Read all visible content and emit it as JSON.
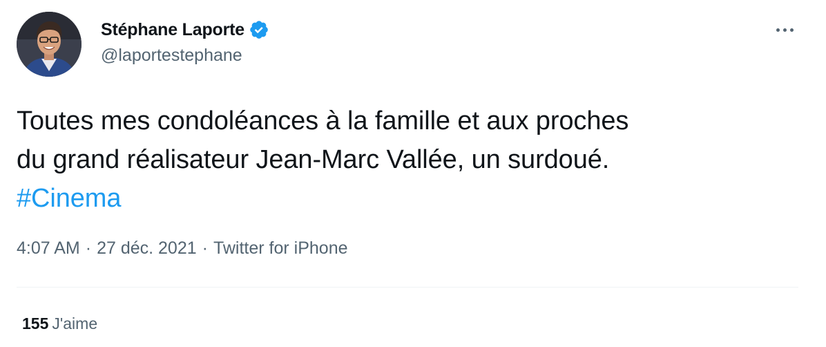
{
  "author": {
    "display_name": "Stéphane Laporte",
    "handle": "@laportestephane",
    "verified": true,
    "avatar_icon": "profile-photo"
  },
  "tweet": {
    "lines": [
      "Toutes mes condoléances à la famille et aux proches",
      "du grand réalisateur Jean-Marc Vallée, un surdoué."
    ],
    "hashtag": "#Cinema"
  },
  "meta": {
    "time": "4:07 AM",
    "separator": "·",
    "date": "27 déc. 2021",
    "source": "Twitter for iPhone"
  },
  "stats": {
    "likes_count": "155",
    "likes_label": "J'aime"
  },
  "icons": {
    "more": "more-horizontal-icon",
    "verified": "verified-badge-icon"
  },
  "colors": {
    "link": "#1d9bf0",
    "text_primary": "#0f1419",
    "text_secondary": "#536471",
    "divider": "#eff3f4"
  }
}
